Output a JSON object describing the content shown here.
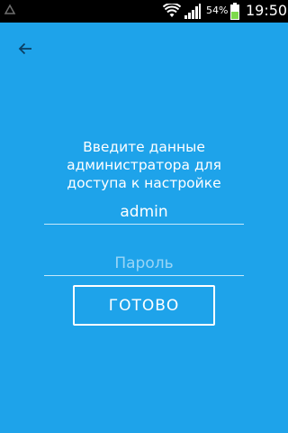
{
  "status_bar": {
    "battery_percent": "54%",
    "time": "19:50",
    "icons": [
      "notification-icon",
      "wifi-icon",
      "signal-icon",
      "battery-icon"
    ]
  },
  "header": {
    "back_icon": "arrow-left-icon"
  },
  "login": {
    "prompt_line1": "Введите данные",
    "prompt_line2": "администратора для",
    "prompt_line3": "доступа к настройке",
    "username_value": "admin",
    "password_placeholder": "Пароль",
    "submit_label": "ГОТОВО"
  },
  "colors": {
    "background": "#1ea3ea",
    "status_bar": "#000000",
    "battery_fill": "#7dd94b",
    "text": "#ffffff"
  }
}
